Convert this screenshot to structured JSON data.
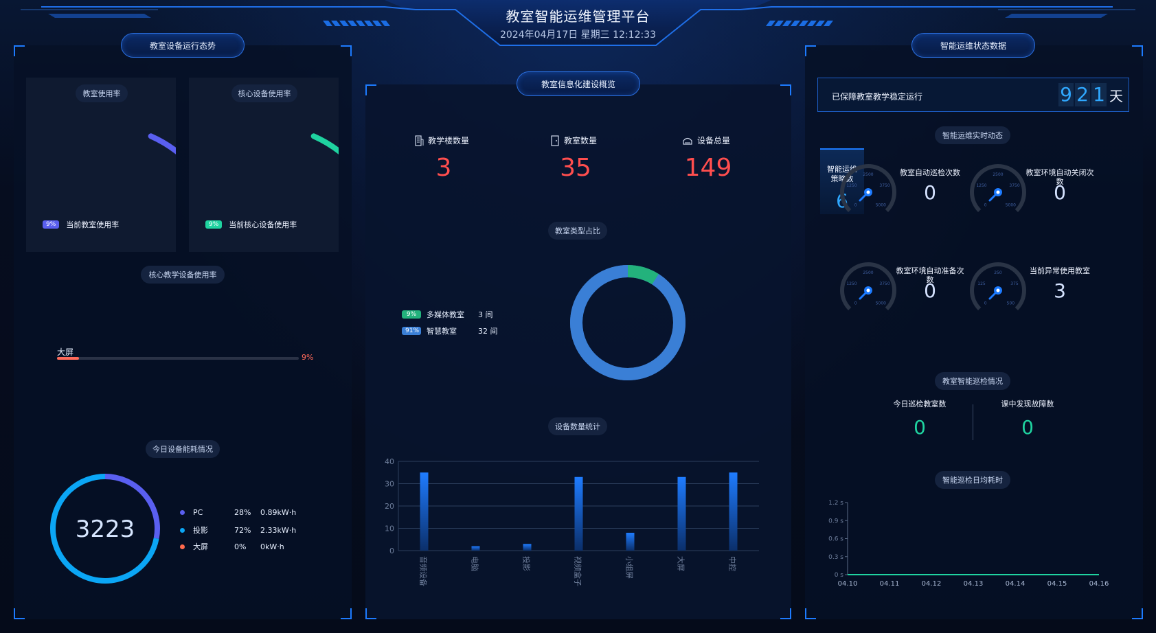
{
  "header": {
    "title": "教室智能运维管理平台",
    "datetime": "2024年04月17日 星期三 12:12:33"
  },
  "left": {
    "panel_title": "教室设备运行态势",
    "card1": {
      "title": "教室使用率",
      "tag": "9%",
      "label": "当前教室使用率",
      "value": 0.09,
      "color": "#5a5ff0"
    },
    "card2": {
      "title": "核心设备使用率",
      "tag": "9%",
      "label": "当前核心设备使用率",
      "value": 0.09,
      "color": "#1fd3a0"
    },
    "core_title": "核心教学设备使用率",
    "core_bar": {
      "name": "大屏",
      "value_text": "9%",
      "value": 0.09
    },
    "energy_title": "今日设备能耗情况",
    "energy_total": "3223",
    "energy": [
      {
        "name": "PC",
        "pct": "28%",
        "kwh": "0.89kW·h",
        "share": 0.28,
        "color": "#5a5ff0"
      },
      {
        "name": "投影",
        "pct": "72%",
        "kwh": "2.33kW·h",
        "share": 0.72,
        "color": "#0ba6f5"
      },
      {
        "name": "大屏",
        "pct": "0%",
        "kwh": "0kW·h",
        "share": 0.0,
        "color": "#ff6a4d"
      }
    ]
  },
  "center": {
    "panel_title": "教室信息化建设概览",
    "stats": [
      {
        "label": "教学楼数量",
        "value": "3",
        "icon": "building-icon"
      },
      {
        "label": "教室数量",
        "value": "35",
        "icon": "door-icon"
      },
      {
        "label": "设备总量",
        "value": "149",
        "icon": "device-icon"
      }
    ],
    "type_title": "教室类型占比",
    "types": [
      {
        "tag": "9%",
        "name": "多媒体教室",
        "count": "3 间",
        "share": 0.09,
        "color": "#23b27c"
      },
      {
        "tag": "91%",
        "name": "智慧教室",
        "count": "32 间",
        "share": 0.91,
        "color": "#3a7fd6"
      }
    ],
    "device_title": "设备数量统计"
  },
  "chart_data": [
    {
      "type": "bar",
      "categories": [
        "音频设备",
        "电脑",
        "投影",
        "视频盒子",
        "小组屏",
        "大屏",
        "中控"
      ],
      "values": [
        35,
        2,
        3,
        33,
        8,
        33,
        35
      ],
      "ylim": [
        0,
        40
      ],
      "yticks": [
        0,
        10,
        20,
        30,
        40
      ],
      "grid": true
    },
    {
      "type": "line",
      "title": "智能巡检日均耗时",
      "x": [
        "04.10",
        "04.11",
        "04.12",
        "04.13",
        "04.14",
        "04.15",
        "04.16"
      ],
      "values": [
        0,
        0,
        0,
        0,
        0,
        0,
        0
      ],
      "yticks": [
        "1.2 s",
        "0.9 s",
        "0.6 s",
        "0.3 s",
        "0 s"
      ],
      "ylim": [
        0,
        1.2
      ]
    }
  ],
  "right": {
    "panel_title": "智能运维状态数据",
    "stable_label": "已保障教室教学稳定运行",
    "stable_digits": [
      "9",
      "2",
      "1"
    ],
    "stable_unit": "天",
    "realtime_title": "智能运维实时动态",
    "strategy_label": "智能运维策略数",
    "strategy_value": "6",
    "gauges": [
      {
        "label": "教室自动巡检次数",
        "value": "0",
        "ticks": [
          "0",
          "1250",
          "2500",
          "3750",
          "5000"
        ]
      },
      {
        "label": "教室环境自动关闭次数",
        "value": "0",
        "ticks": [
          "0",
          "1250",
          "2500",
          "3750",
          "5000"
        ]
      },
      {
        "label": "教室环境自动准备次数",
        "value": "0",
        "ticks": [
          "0",
          "1250",
          "2500",
          "3750",
          "5000"
        ]
      },
      {
        "label": "当前异常使用教室",
        "value": "3",
        "ticks": [
          "0",
          "125",
          "250",
          "375",
          "500"
        ]
      }
    ],
    "inspect_title": "教室智能巡检情况",
    "inspect_today_label": "今日巡检教室数",
    "inspect_today_value": "0",
    "inspect_fault_label": "课中发现故障数",
    "inspect_fault_value": "0",
    "duration_title": "智能巡检日均耗时"
  }
}
